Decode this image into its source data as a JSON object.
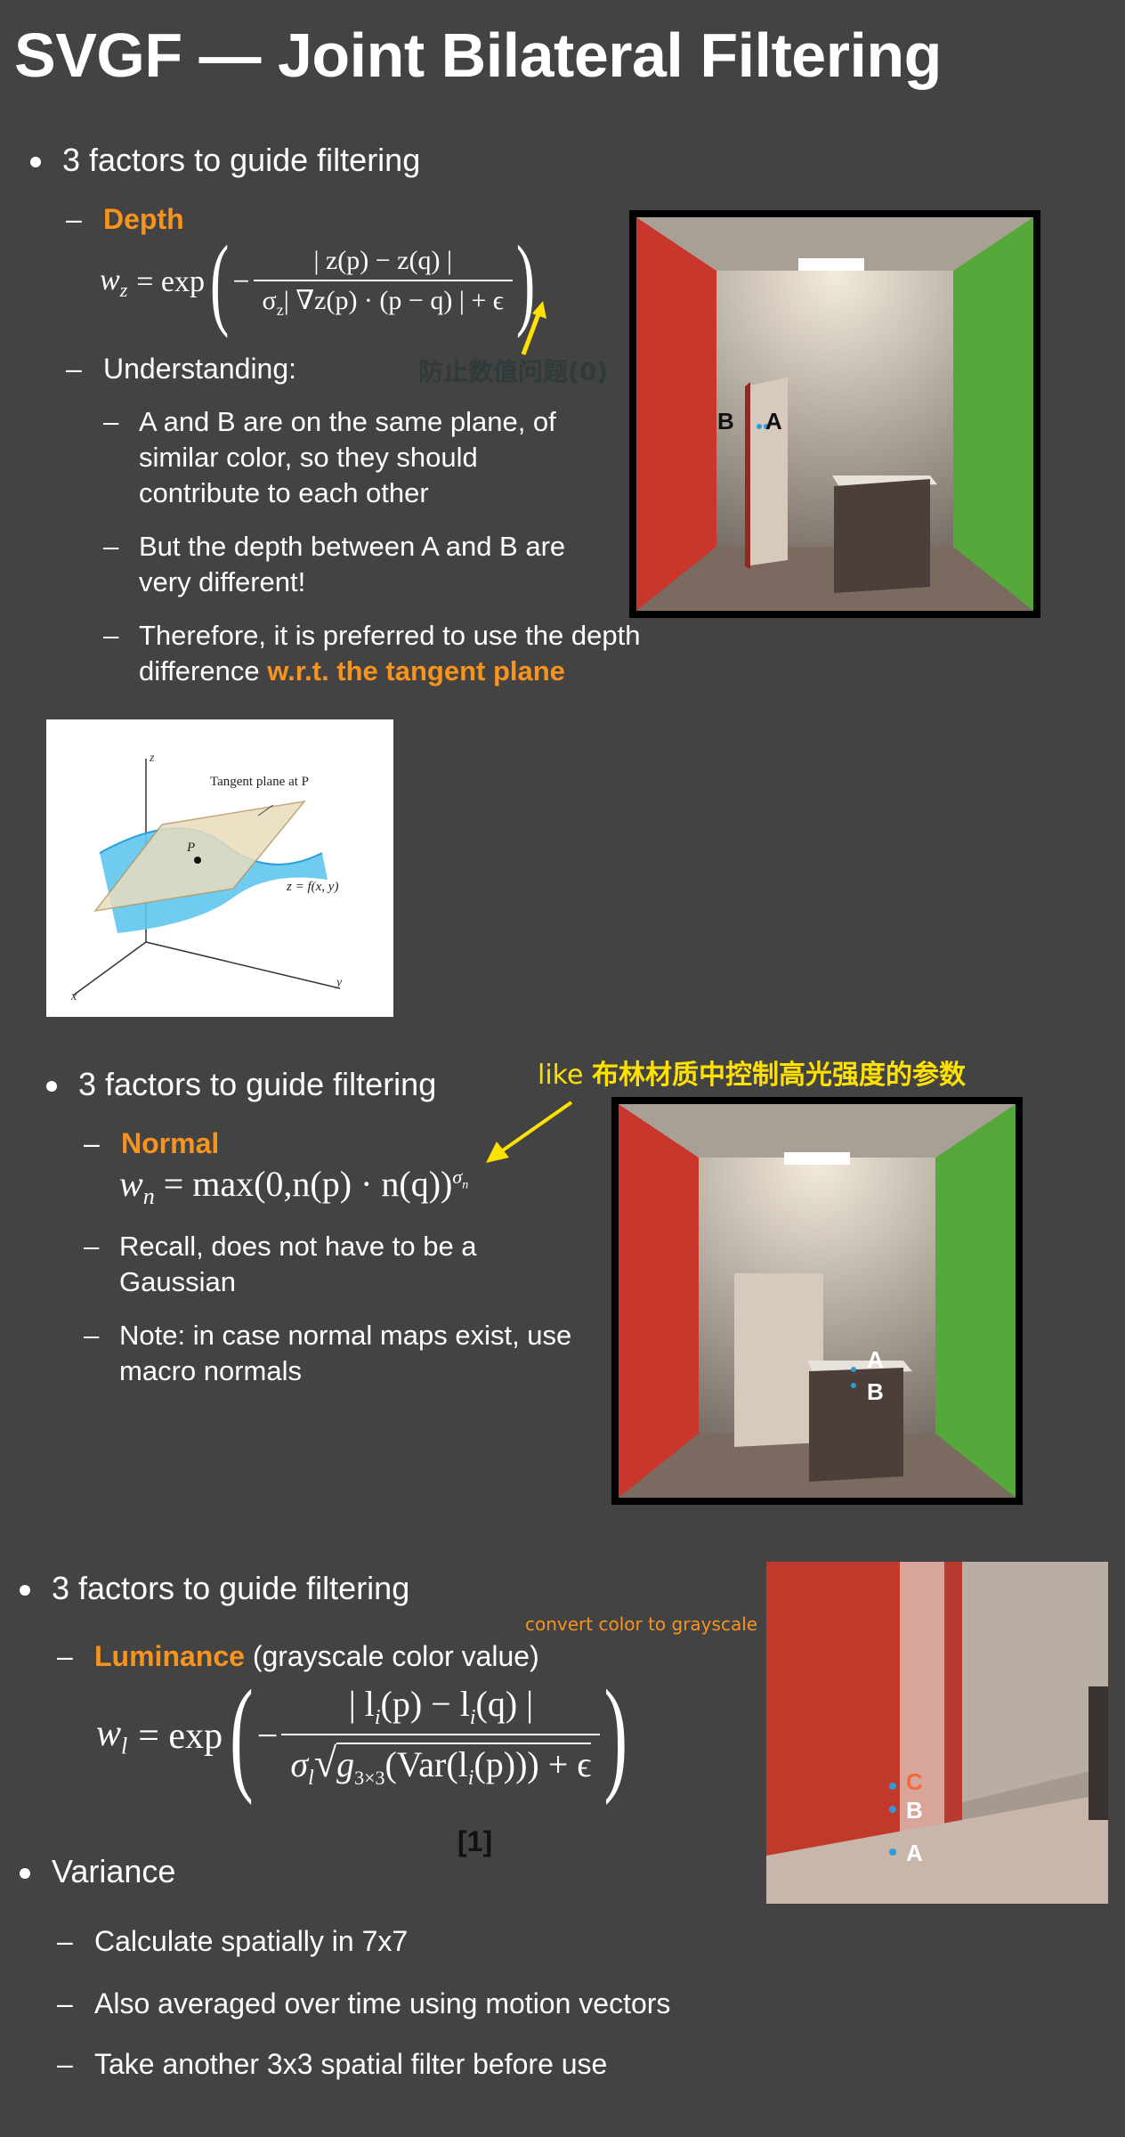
{
  "title": "SVGF — Joint Bilateral Filtering",
  "section1": {
    "bullet": "3 factors to guide filtering",
    "depth_label": "Depth",
    "formula": {
      "lhs": "w",
      "lhs_sub": "z",
      "eq": "= exp",
      "numerator": "| z(p) − z(q) |",
      "denominator": "σ",
      "denominator_sub": "z",
      "denominator_rest": "| ∇z(p) · (p − q) | + ϵ"
    },
    "annotation": "防止数值问题(0)",
    "understanding": "Understanding:",
    "points": [
      "A and B are on the same plane, of similar color, so they should contribute to each other",
      "But the depth between A and B are very different!",
      "Therefore, it is preferred to use the depth difference "
    ],
    "highlight": "w.r.t. the tangent plane",
    "image_labels": {
      "b": "B",
      "a": "A"
    },
    "diagram": {
      "z": "z",
      "x": "x",
      "y": "y",
      "tangent": "Tangent plane at P",
      "p": "P",
      "fn": "z = f(x, y)"
    }
  },
  "section2": {
    "bullet": "3 factors to guide filtering",
    "annotation_prefix": "like ",
    "annotation": "布林材质中控制高光强度的参数",
    "normal_label": "Normal",
    "formula": {
      "lhs": "w",
      "lhs_sub": "n",
      "rhs": "= max(0,n(p) · n(q))",
      "exp": "σ",
      "exp_sub": "n"
    },
    "points": [
      "Recall, does not have to be a Gaussian",
      "Note: in case normal maps exist, use macro normals"
    ],
    "image_labels": {
      "a": "A",
      "b": "B"
    }
  },
  "section3": {
    "bullet": "3 factors to guide filtering",
    "annotation": "convert color to grayscale",
    "luminance_label": "Luminance",
    "luminance_note": " (grayscale color value)",
    "formula": {
      "lhs": "w",
      "lhs_sub": "l",
      "eq": "= exp",
      "numerator": "| l",
      "numerator_rest": "(p) − l",
      "numerator_end": "(q) |",
      "sub_i": "i",
      "den_sigma": "σ",
      "den_sigma_sub": "l",
      "den_g": "g",
      "den_g_sub": "3×3",
      "den_var": "(Var(l",
      "den_var_end": "(p))) + ϵ"
    },
    "ref": "[1]",
    "variance": "Variance",
    "variance_points": [
      "Calculate spatially in 7x7",
      "Also averaged over time using motion vectors",
      "Take another 3x3 spatial filter before use"
    ],
    "image_labels": {
      "c": "C",
      "b": "B",
      "a": "A"
    }
  },
  "colors": {
    "background": "#434343",
    "accent_orange": "#f7941d",
    "annotation_yellow": "#ffe100",
    "point_blue": "#2e9bd6"
  }
}
